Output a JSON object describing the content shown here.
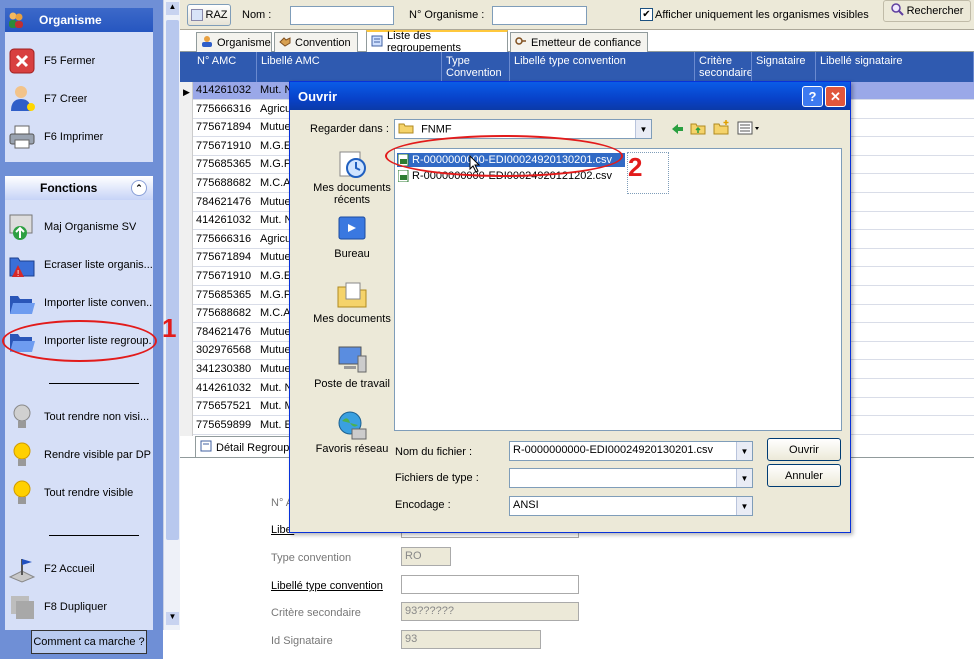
{
  "left_panel": {
    "org_title": "Organisme",
    "org_items": [
      "F5 Fermer",
      "F7 Creer",
      "F6 Imprimer"
    ],
    "func_title": "Fonctions",
    "func_items": [
      "Maj Organisme SV",
      "Ecraser liste organis...",
      "Importer liste conven...",
      "Importer liste regroup...",
      "Tout rendre non visi...",
      "Rendre visible par DP",
      "Tout rendre visible",
      "F2 Accueil",
      "F8 Dupliquer"
    ],
    "help_button": "Comment ca marche ?"
  },
  "toolbar": {
    "raz": "RAZ",
    "nom_label": "Nom :",
    "nom_value": "",
    "norg_label": "N° Organisme :",
    "norg_value": "",
    "checkbox_label": "Afficher uniquement les organismes visibles",
    "checkbox_checked": true,
    "search_button": "Rechercher"
  },
  "tabs": [
    "Organisme",
    "Convention",
    "Liste des regroupements",
    "Emetteur de confiance"
  ],
  "grid": {
    "headers": [
      "N° AMC",
      "Libellé AMC",
      "Type Convention",
      "Libellé type convention",
      "Critère secondaire",
      "Signataire",
      "Libellé signataire"
    ],
    "rows": [
      [
        "414261032",
        "Mut. N"
      ],
      [
        "775666316",
        "Agricul"
      ],
      [
        "775671894",
        "Mutuel"
      ],
      [
        "775671910",
        "M.G.E."
      ],
      [
        "775685365",
        "M.G.P."
      ],
      [
        "775688682",
        "M.C.A"
      ],
      [
        "784621476",
        "Mutuel"
      ],
      [
        "414261032",
        "Mut. N"
      ],
      [
        "775666316",
        "Agricul"
      ],
      [
        "775671894",
        "Mutuel"
      ],
      [
        "775671910",
        "M.G.E."
      ],
      [
        "775685365",
        "M.G.P."
      ],
      [
        "775688682",
        "M.C.A"
      ],
      [
        "784621476",
        "Mutuel"
      ],
      [
        "302976568",
        "Mutuel"
      ],
      [
        "341230380",
        "Mutuel"
      ],
      [
        "414261032",
        "Mut. N"
      ],
      [
        "775657521",
        "Mut. M"
      ],
      [
        "775659899",
        "Mut. E"
      ]
    ]
  },
  "detail": {
    "tab": "Détail Regroup",
    "fields": [
      {
        "label": "N° A",
        "value": ""
      },
      {
        "label": "Libel",
        "value": ""
      },
      {
        "label": "Type convention",
        "value": "RO"
      },
      {
        "label": "Libellé type convention",
        "value": ""
      },
      {
        "label": "Critère secondaire",
        "value": "93??????"
      },
      {
        "label": "Id Signataire",
        "value": "93"
      }
    ]
  },
  "dialog": {
    "title": "Ouvrir",
    "look_in_label": "Regarder dans :",
    "look_in_value": "FNMF",
    "places": [
      "Mes documents récents",
      "Bureau",
      "Mes documents",
      "Poste de travail",
      "Favoris réseau"
    ],
    "files": [
      "R-0000000000-EDI00024920130201.csv",
      "R-0000000000-EDI00024920121202.csv"
    ],
    "filename_label": "Nom du fichier :",
    "filename_value": "R-0000000000-EDI00024920130201.csv",
    "filetype_label": "Fichiers de type :",
    "filetype_value": "",
    "encoding_label": "Encodage :",
    "encoding_value": "ANSI",
    "open_button": "Ouvrir",
    "cancel_button": "Annuler"
  },
  "annotations": [
    "1",
    "2"
  ]
}
